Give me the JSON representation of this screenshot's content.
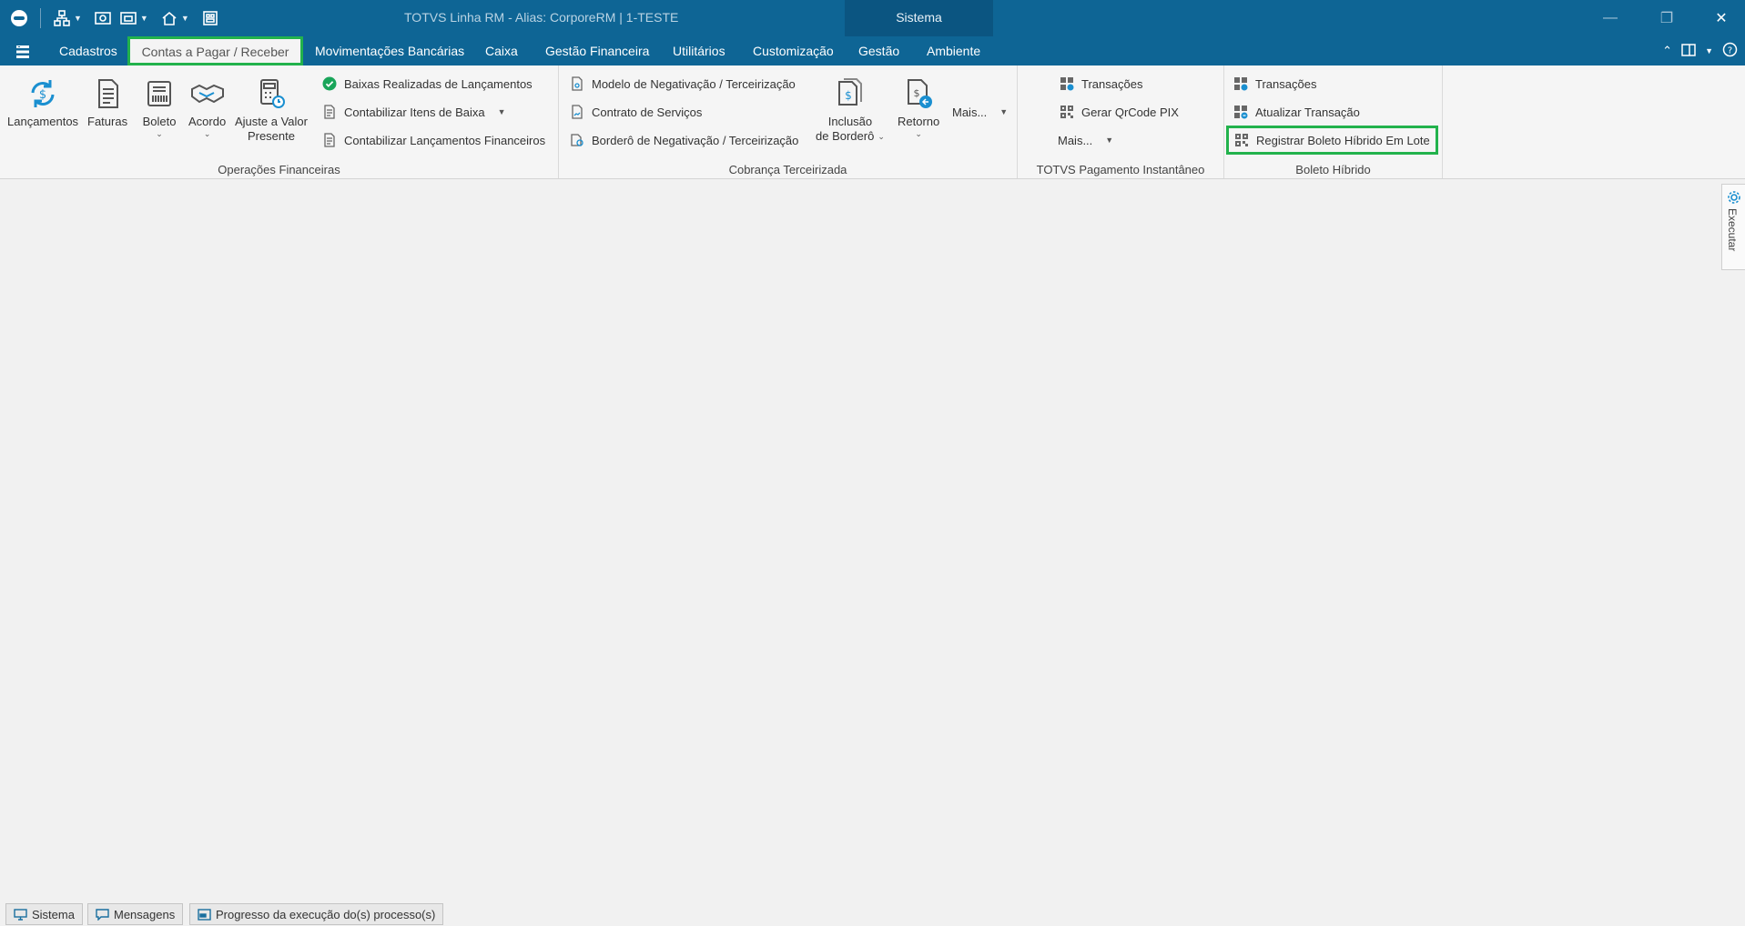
{
  "window": {
    "title": "TOTVS Linha RM - Alias: CorporeRM | 1-TESTE",
    "context_tab": "Sistema"
  },
  "menu": {
    "items": [
      "Cadastros",
      "Contas a Pagar / Receber",
      "Movimentações Bancárias",
      "Caixa",
      "Gestão Financeira",
      "Utilitários",
      "Customização",
      "Gestão",
      "Ambiente"
    ],
    "active": "Contas a Pagar / Receber"
  },
  "ribbon": {
    "operacoes": {
      "label": "Operações Financeiras",
      "lancamentos": "Lançamentos",
      "faturas": "Faturas",
      "boleto": "Boleto",
      "acordo": "Acordo",
      "ajuste_l1": "Ajuste a Valor",
      "ajuste_l2": "Presente",
      "baixas": "Baixas Realizadas de Lançamentos",
      "contab_itens": "Contabilizar Itens de Baixa",
      "contab_lanc": "Contabilizar Lançamentos Financeiros"
    },
    "cobranca": {
      "label": "Cobrança Terceirizada",
      "modelo": "Modelo de Negativação / Terceirização",
      "contrato": "Contrato de Serviços",
      "bordero": "Borderô de Negativação / Terceirização",
      "inclusao_l1": "Inclusão",
      "inclusao_l2": "de Borderô",
      "retorno": "Retorno",
      "mais": "Mais..."
    },
    "pix": {
      "label": "TOTVS Pagamento Instantâneo",
      "transacoes": "Transações",
      "gerar_qr": "Gerar QrCode PIX",
      "mais": "Mais..."
    },
    "hibrido": {
      "label": "Boleto Híbrido",
      "transacoes": "Transações",
      "atualizar": "Atualizar Transação",
      "registrar": "Registrar Boleto Híbrido Em Lote"
    }
  },
  "side_panel": {
    "label": "Executar"
  },
  "statusbar": {
    "sistema": "Sistema",
    "mensagens": "Mensagens",
    "progresso": "Progresso da execução do(s) processo(s)"
  },
  "colors": {
    "primary": "#0e6595",
    "highlight": "#22b24c",
    "accent": "#1a8fd0"
  }
}
